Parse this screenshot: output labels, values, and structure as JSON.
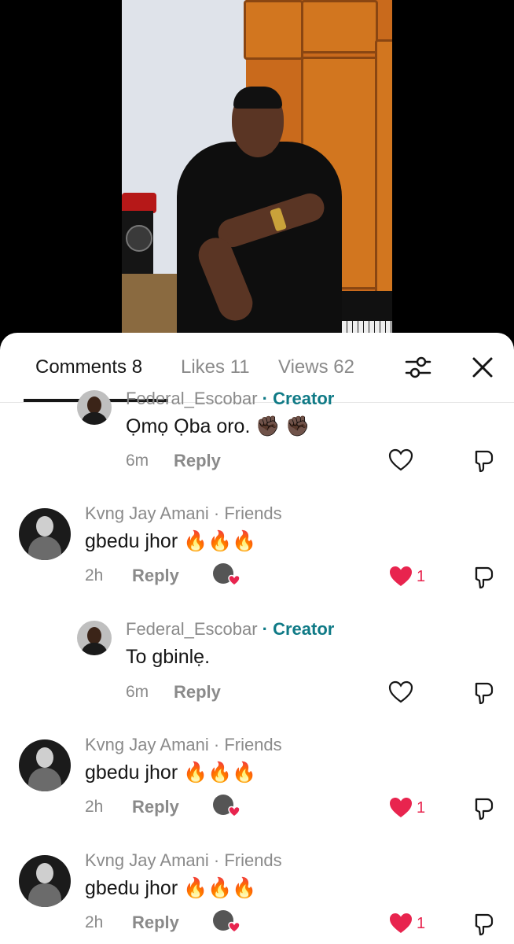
{
  "tabs": {
    "comments": "Comments 8",
    "likes": "Likes 11",
    "views": "Views 62"
  },
  "comments": [
    {
      "meta_name": "Federal_Escobar",
      "meta_tag": "· Creator",
      "text": "Ọmọ Ọba oro. ✊🏿 ✊🏿",
      "time": "6m",
      "reply": "Reply"
    },
    {
      "meta_name": "Kvng  Jay  Amani",
      "meta_tag": "· Friends",
      "text": "gbedu jhor 🔥🔥🔥",
      "time": "2h",
      "reply": "Reply",
      "likes": "1"
    },
    {
      "meta_name": "Federal_Escobar",
      "meta_tag": "· Creator",
      "text": "To gbinlẹ.",
      "time": "6m",
      "reply": "Reply"
    },
    {
      "meta_name": "Kvng  Jay  Amani",
      "meta_tag": "· Friends",
      "text": "gbedu jhor 🔥🔥🔥",
      "time": "2h",
      "reply": "Reply",
      "likes": "1"
    },
    {
      "meta_name": "Kvng  Jay  Amani",
      "meta_tag": "· Friends",
      "text": "gbedu jhor 🔥🔥🔥",
      "time": "2h",
      "reply": "Reply",
      "likes": "1"
    }
  ],
  "colors": {
    "creator_tag": "#0f7a86",
    "liked_heart": "#e8244e",
    "text_primary": "#161616",
    "text_secondary": "#8a8a8a"
  },
  "icons": {
    "filter": "sliders-icon",
    "close": "close-icon",
    "like": "heart-icon",
    "dislike": "thumbs-down-icon"
  }
}
